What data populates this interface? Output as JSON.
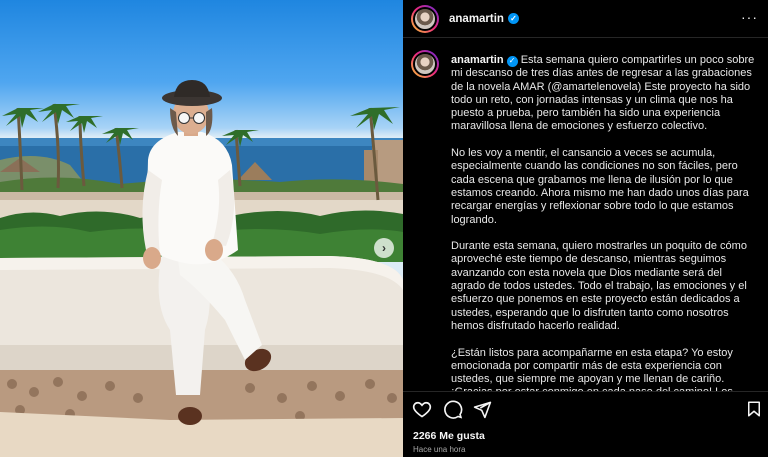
{
  "post": {
    "username": "anamartin",
    "caption_username": "anamartin",
    "caption_paragraphs": [
      "Esta semana quiero compartirles un poco sobre mi descanso de tres días antes de regresar a las grabaciones de la novela AMAR (@amartelenovela) Este proyecto ha sido todo un reto, con jornadas intensas y un clima que nos ha puesto a prueba, pero también ha sido una experiencia maravillosa llena de emociones y esfuerzo colectivo.",
      "No les voy a mentir, el cansancio a veces se acumula, especialmente cuando las condiciones no son fáciles, pero cada escena que grabamos me llena de ilusión por lo que estamos creando. Ahora mismo me han dado unos días para recargar energías y reflexionar sobre todo lo que estamos logrando.",
      "Durante esta semana, quiero mostrarles un poquito de cómo aproveché este tiempo de descanso, mientras seguimos avanzando con esta novela que Dios mediante será del agrado de todos ustedes. Todo el trabajo, las emociones y el esfuerzo que ponemos en este proyecto están dedicados a ustedes, esperando que lo disfruten tanto como nosotros hemos disfrutado hacerlo realidad.",
      "¿Están listos para acompañarme en esta etapa? Yo estoy emocionada por compartir más de esta experiencia con ustedes, que siempre me apoyan y me llenan de cariño. ¡Gracias por estar conmigo en cada paso del camino! Los amo con todo mi"
    ],
    "likes": "2266 Me gusta",
    "timestamp": "Hace una hora"
  },
  "icons": {
    "verified": "verified-badge",
    "more": "more-options",
    "like": "heart-icon",
    "comment": "comment-icon",
    "share": "share-icon",
    "save": "bookmark-icon",
    "carousel": "chevron-right-icon"
  },
  "colors": {
    "background": "#000000",
    "verified": "#0095f6",
    "divider": "#262626",
    "muted": "#a8a8a8"
  }
}
